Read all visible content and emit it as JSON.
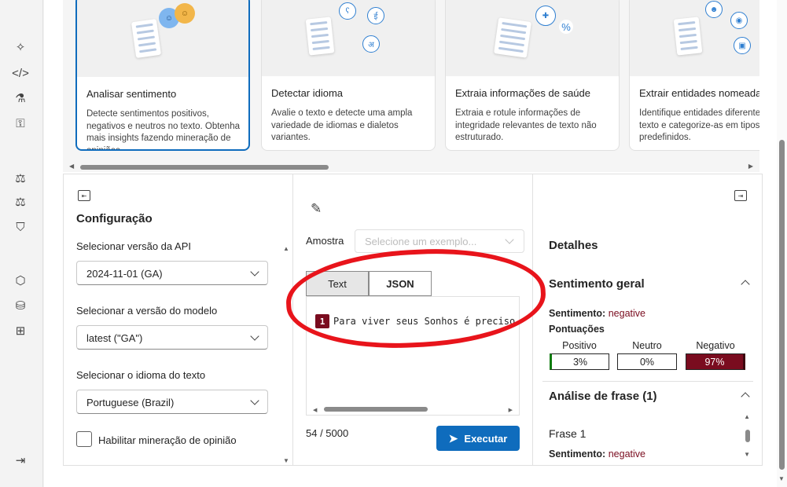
{
  "cards": [
    {
      "title": "Analisar sentimento",
      "desc": "Detecte sentimentos positivos, negativos e neutros no texto. Obtenha mais insights fazendo mineração de opiniões.",
      "selected": true
    },
    {
      "title": "Detectar idioma",
      "desc": "Avalie o texto e detecte uma ampla variedade de idiomas e dialetos variantes.",
      "selected": false
    },
    {
      "title": "Extraia informações de saúde",
      "desc": "Extraia e rotule informações de integridade relevantes de texto não estruturado.",
      "selected": false
    },
    {
      "title": "Extrair entidades nomeadas",
      "desc": "Identifique entidades diferentes no texto e categorize-as em tipos predefinidos.",
      "selected": false
    }
  ],
  "config": {
    "title": "Configuração",
    "api_label": "Selecionar versão da API",
    "api_value": "2024-11-01 (GA)",
    "model_label": "Selecionar a versão do modelo",
    "model_value": "latest (\"GA\")",
    "lang_label": "Selecionar o idioma do texto",
    "lang_value": "Portuguese (Brazil)",
    "opinion_label": "Habilitar mineração de opinião"
  },
  "input": {
    "sample_label": "Amostra",
    "sample_placeholder": "Selecione um exemplo...",
    "tab_text": "Text",
    "tab_json": "JSON",
    "line_number": "1",
    "code": "Para viver seus Sonhos é preciso",
    "counter": "54 / 5000",
    "run_label": "Executar"
  },
  "details": {
    "title": "Detalhes",
    "overall_title": "Sentimento geral",
    "sentiment_key": "Sentimento:",
    "sentiment_value": "negative",
    "scores_title": "Pontuações",
    "pos_label": "Positivo",
    "neu_label": "Neutro",
    "neg_label": "Negativo",
    "pos_value": "3%",
    "neu_value": "0%",
    "neg_value": "97%",
    "sentence_title": "Análise de frase (1)",
    "sentence_name": "Frase 1",
    "sentence_sentiment_key": "Sentimento:",
    "sentence_sentiment_value": "negative"
  },
  "colors": {
    "accent": "#0f6cbd",
    "negative": "#7a0c1f",
    "annotation": "#e8141b"
  }
}
